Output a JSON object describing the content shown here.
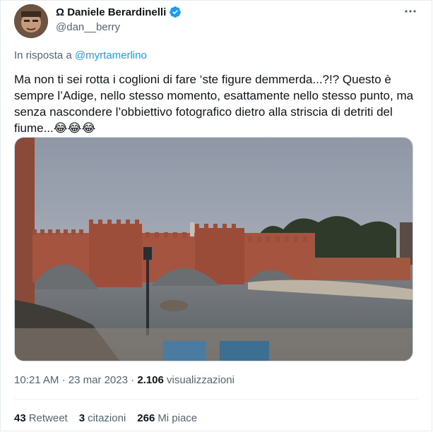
{
  "author": {
    "name": "Ω Daniele Berardinelli",
    "handle": "@dan__berry",
    "verified_color": "#1d9bf0"
  },
  "reply": {
    "prefix": "In risposta a",
    "to": "@myrtamerlino"
  },
  "tweet": {
    "text": "Ma non ti sei rotta i coglioni di fare ‘ste figure demmerda...?!? Questo è sempre l’Adige, nello stesso momento, esattamente nello stesso punto, ma senza nascondere l’obbiettivo fotografico dietro alla striscia di detriti del fiume...",
    "emojis": "😂😂😂"
  },
  "meta": {
    "time": "10:21 AM",
    "separator1": "·",
    "date": "23 mar 2023",
    "separator2": "·",
    "views_count": "2.106",
    "views_label": "visualizzazioni"
  },
  "stats": {
    "retweets_count": "43",
    "retweets_label": "Retweet",
    "quotes_count": "3",
    "quotes_label": "citazioni",
    "likes_count": "266",
    "likes_label": "Mi piace"
  },
  "more_icon": "more-horizontal-icon",
  "colors": {
    "link": "#1d9bf0",
    "secondary_text": "#536471",
    "primary_text": "#0f1419"
  }
}
